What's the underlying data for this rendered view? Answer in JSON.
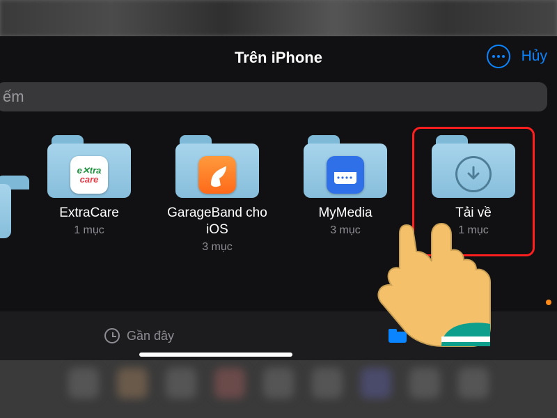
{
  "header": {
    "title": "Trên iPhone",
    "cancel_label": "Hủy"
  },
  "search": {
    "placeholder_fragment": "ếm"
  },
  "folders": [
    {
      "name": "ExtraCare",
      "meta": "1 mục",
      "badge": "extracare"
    },
    {
      "name": "GarageBand cho iOS",
      "meta": "3 mục",
      "badge": "garageband"
    },
    {
      "name": "MyMedia",
      "meta": "3 mục",
      "badge": "mymedia"
    },
    {
      "name": "Tải về",
      "meta": "1 mục",
      "badge": "download",
      "highlighted": true
    }
  ],
  "tabbar": {
    "recent_label": "Gần đây",
    "browse_label": "Duyệt"
  }
}
